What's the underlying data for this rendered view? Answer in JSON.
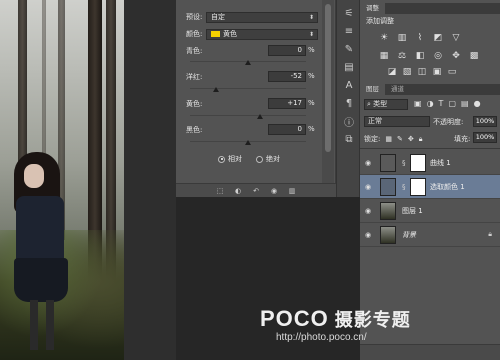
{
  "properties": {
    "preset_label": "预设:",
    "preset_value": "自定",
    "color_label": "颜色:",
    "color_value": "黄色",
    "swatch_color": "#f5d100",
    "sliders": [
      {
        "label": "青色:",
        "value": "0"
      },
      {
        "label": "洋红:",
        "value": "-52"
      },
      {
        "label": "黄色:",
        "value": "+17"
      },
      {
        "label": "黑色:",
        "value": "0"
      }
    ],
    "percent_sign": "%",
    "method_relative": "相对",
    "method_absolute": "绝对",
    "selected_method": "relative"
  },
  "adjustments": {
    "tab_label": "调整",
    "title": "添加调整"
  },
  "layers_panel": {
    "tab_layers": "图层",
    "tab_channels": "通道",
    "kind_value": "类型",
    "blend_mode": "正常",
    "opacity_label": "不透明度:",
    "opacity_value": "100%",
    "lock_label": "锁定:",
    "fill_label": "填充:",
    "fill_value": "100%",
    "layers": [
      {
        "name": "曲线 1"
      },
      {
        "name": "选取颜色 1"
      },
      {
        "name": "图层 1"
      },
      {
        "name": "背景"
      }
    ]
  },
  "watermark": {
    "brand": "POCO",
    "cn": "摄影专题",
    "url": "http://photo.poco.cn/"
  }
}
